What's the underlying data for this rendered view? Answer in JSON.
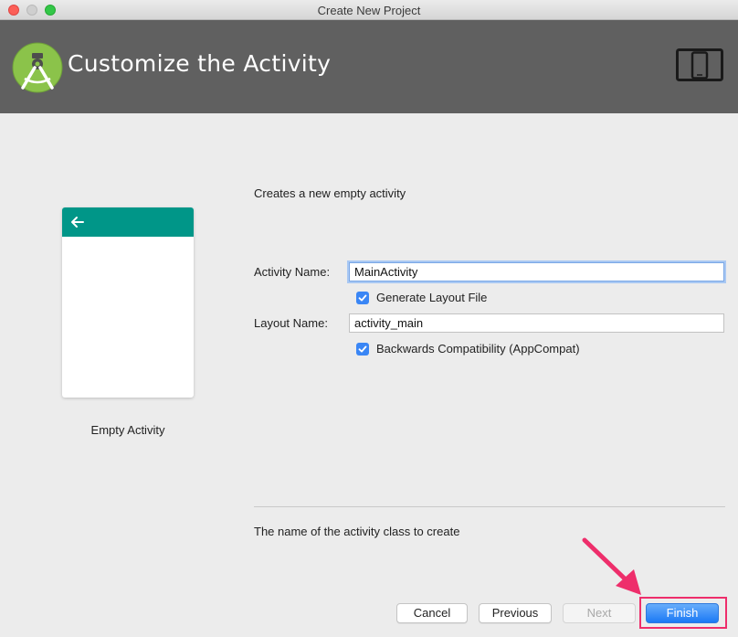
{
  "window": {
    "title": "Create New Project"
  },
  "banner": {
    "title": "Customize the Activity",
    "logo_icon": "android-studio-logo-icon",
    "device_icon": "tablet-phone-icon"
  },
  "preview": {
    "label": "Empty Activity",
    "toolbar_color": "#009688",
    "back_icon": "back-arrow-icon"
  },
  "form": {
    "description": "Creates a new empty activity",
    "activity_name_label": "Activity Name:",
    "activity_name_value": "MainActivity",
    "generate_layout_label": "Generate Layout File",
    "generate_layout_checked": true,
    "layout_name_label": "Layout Name:",
    "layout_name_value": "activity_main",
    "backwards_compat_label": "Backwards Compatibility (AppCompat)",
    "backwards_compat_checked": true
  },
  "hint": "The name of the activity class to create",
  "buttons": {
    "cancel": "Cancel",
    "previous": "Previous",
    "next": "Next",
    "finish": "Finish"
  },
  "colors": {
    "accent": "#1b79f5",
    "highlight": "#ee2e6b",
    "banner": "#606060"
  }
}
